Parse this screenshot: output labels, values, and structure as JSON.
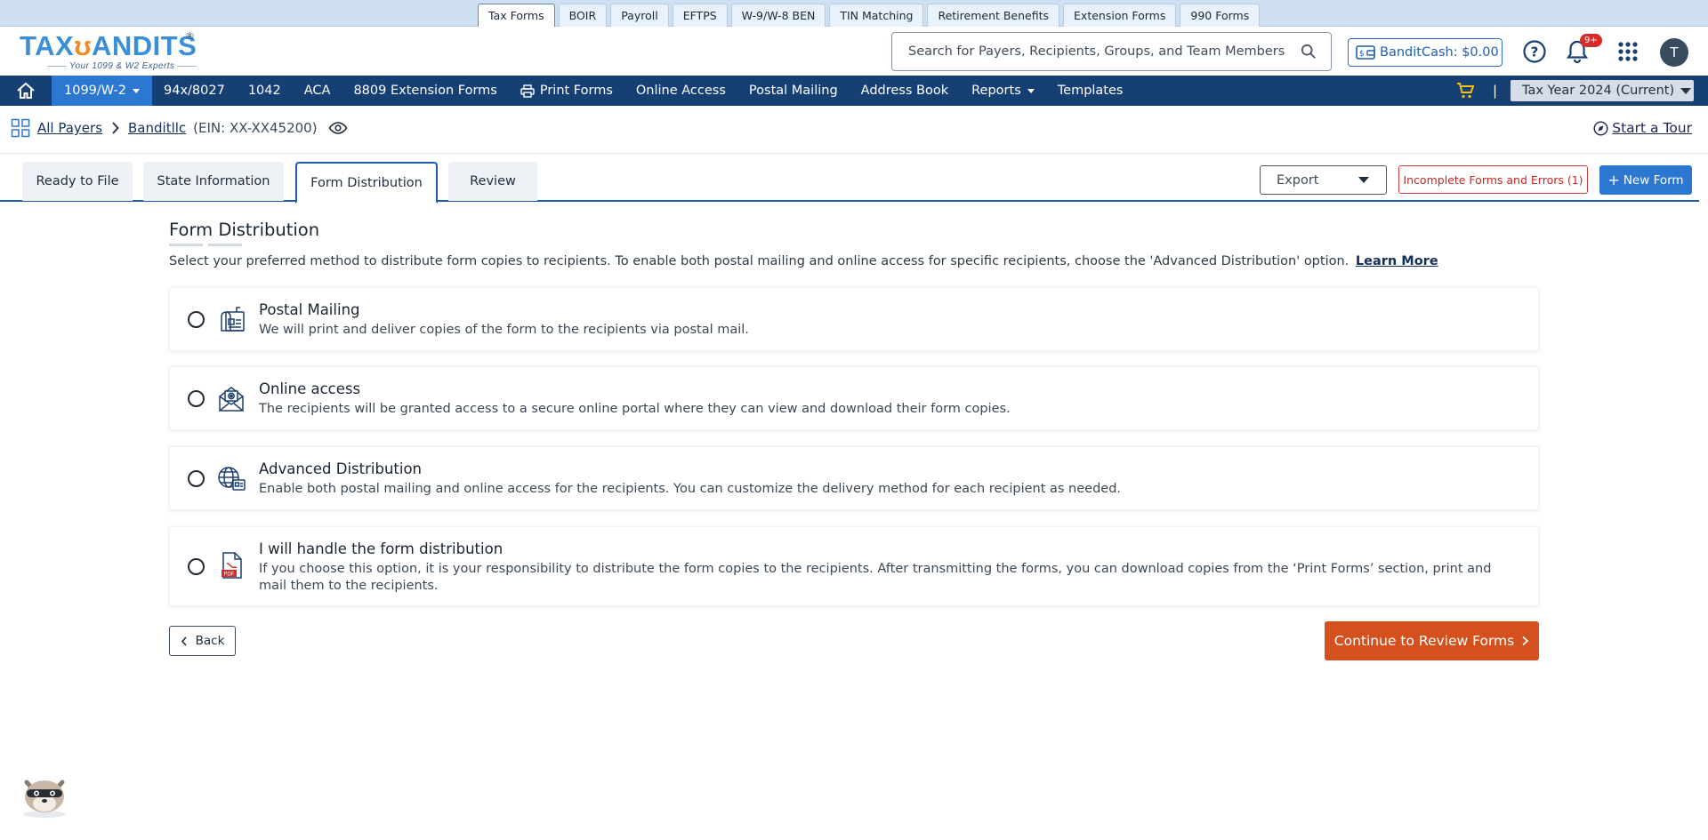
{
  "product_tabs": [
    "Tax Forms",
    "BOIR",
    "Payroll",
    "EFTPS",
    "W-9/W-8 BEN",
    "TIN Matching",
    "Retirement Benefits",
    "Extension Forms",
    "990 Forms"
  ],
  "active_product_tab": "Tax Forms",
  "logo": {
    "text_a": "TAX",
    "text_b": "ANDITS",
    "registered": "®",
    "tagline": "Your 1099 & W2 Experts"
  },
  "search": {
    "placeholder": "Search for Payers, Recipients, Groups, and Team Members"
  },
  "bandit_cash": {
    "label": "BanditCash:",
    "value": "$0.00"
  },
  "notifications": {
    "badge": "9+"
  },
  "user": {
    "initial": "T"
  },
  "nav": {
    "items": [
      "1099/W-2",
      "94x/8027",
      "1042",
      "ACA",
      "8809 Extension Forms",
      "Print Forms",
      "Online Access",
      "Postal Mailing",
      "Address Book",
      "Reports",
      "Templates"
    ],
    "active": "1099/W-2",
    "separator": "|",
    "tax_year": "Tax Year 2024 (Current)"
  },
  "breadcrumb": {
    "all_payers": "All Payers",
    "payer": "Banditllc",
    "ein": "(EIN: XX-XX45200)"
  },
  "start_tour": "Start a Tour",
  "page_tabs": [
    "Ready to File",
    "State Information",
    "Form Distribution",
    "Review"
  ],
  "active_page_tab": "Form Distribution",
  "toolbar": {
    "export": "Export",
    "incomplete": "Incomplete Forms and Errors (1)",
    "new_form": "New Form",
    "new_form_plus": "+"
  },
  "section": {
    "title": "Form Distribution",
    "description": "Select your preferred method to distribute form copies to recipients. To enable both postal mailing and online access for specific recipients, choose the 'Advanced Distribution' option.",
    "learn_more": "Learn More"
  },
  "options": [
    {
      "icon": "postal-mail-icon",
      "title": "Postal Mailing",
      "desc": "We will print and deliver copies of the form to the recipients via postal mail."
    },
    {
      "icon": "online-access-icon",
      "title": "Online access",
      "desc": "The recipients will be granted access to a secure online portal where they can view and download their form copies."
    },
    {
      "icon": "advanced-distribution-icon",
      "title": "Advanced Distribution",
      "desc": "Enable both postal mailing and online access for the recipients. You can customize the delivery method for each recipient as needed."
    },
    {
      "icon": "pdf-icon",
      "title": "I will handle the form distribution",
      "desc": "If you choose this option, it is your responsibility to distribute the form copies to the recipients. After transmitting the forms, you can download copies from the ‘Print Forms’ section, print and mail them to the recipients."
    }
  ],
  "buttons": {
    "back": "Back",
    "continue": "Continue to Review Forms"
  },
  "colors": {
    "nav_bg": "#163f73",
    "accent_blue": "#2c77d0",
    "continue_orange": "#d4501d",
    "error_red": "#c82525"
  }
}
